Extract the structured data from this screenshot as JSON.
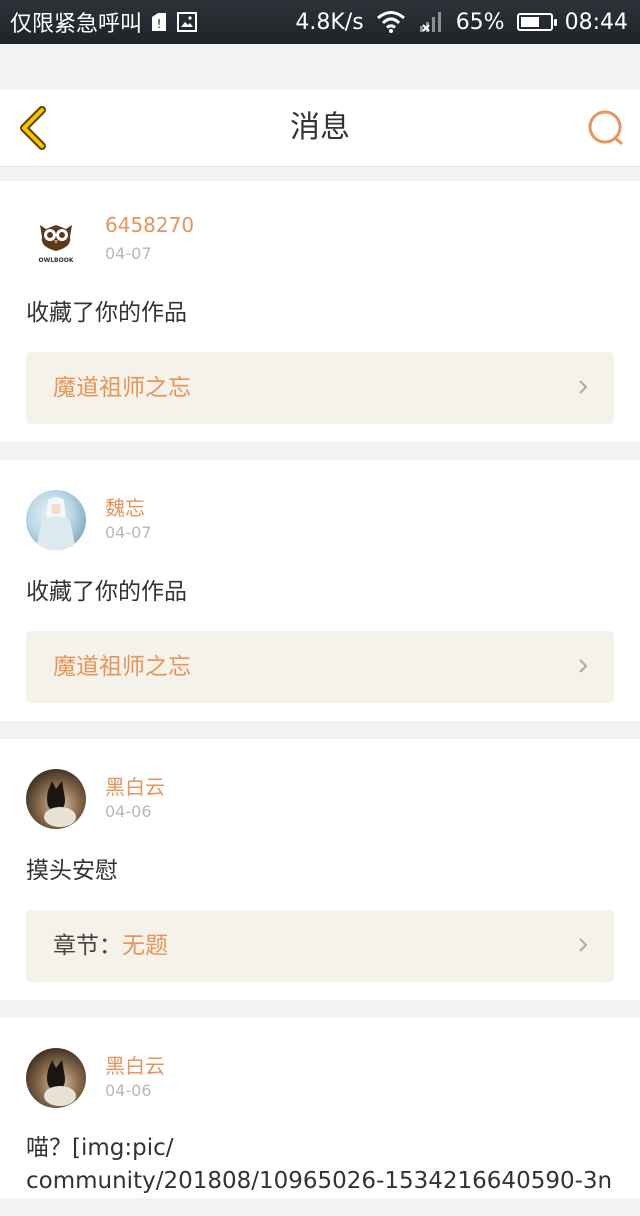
{
  "status_bar": {
    "carrier": "仅限紧急呼叫",
    "speed": "4.8K/s",
    "battery": "65%",
    "battery_level": 0.65,
    "time": "08:44"
  },
  "header": {
    "title": "消息"
  },
  "colors": {
    "accent": "#e8945a",
    "back_icon": "#f5c400"
  },
  "messages": [
    {
      "username": "6458270",
      "date": "04-07",
      "avatar_text": "OWLBOOK",
      "text": "收藏了你的作品",
      "link_prefix": "",
      "link_title": "魔道祖师之忘"
    },
    {
      "username": "魏忘",
      "date": "04-07",
      "text": "收藏了你的作品",
      "link_prefix": "",
      "link_title": "魔道祖师之忘"
    },
    {
      "username": "黑白云",
      "date": "04-06",
      "text": "摸头安慰",
      "link_prefix": "章节：",
      "link_title": "无题"
    },
    {
      "username": "黑白云",
      "date": "04-06",
      "text_line1": "喵？[img:pic/",
      "text_line2": "community/201808/10965026-1534216640590-3n"
    }
  ]
}
